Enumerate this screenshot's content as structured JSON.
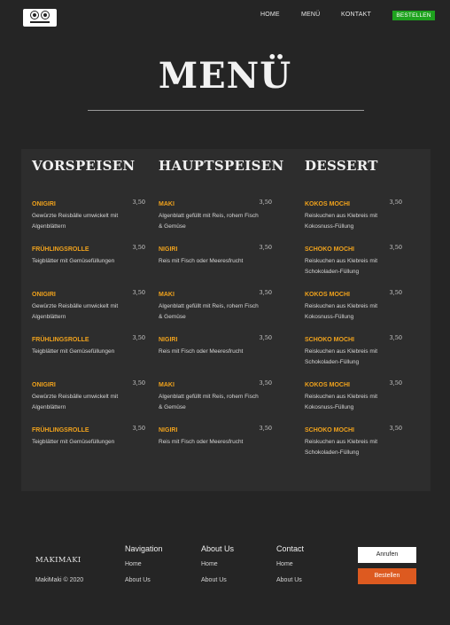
{
  "header": {
    "logo_icon": "sushi-logo-icon",
    "nav": [
      "HOME",
      "MENÜ",
      "KONTAKT"
    ],
    "order_label": "BESTELLEN",
    "order_color": "#1ea21e"
  },
  "page": {
    "title": "MENÜ"
  },
  "menu": {
    "columns": [
      {
        "heading": "VORSPEISEN",
        "items": [
          {
            "name": "ONIGIRI",
            "price": "3,50",
            "desc": "Gewürzte Reisbälle umwickelt mit Algenblättern"
          },
          {
            "name": "FRÜHLINGSROLLE",
            "price": "3,50",
            "desc": "Teigblätter mit Gemüsefüllungen"
          },
          {
            "name": "ONIGIRI",
            "price": "3,50",
            "desc": "Gewürzte Reisbälle umwickelt mit Algenblättern"
          },
          {
            "name": "FRÜHLINGSROLLE",
            "price": "3,50",
            "desc": "Teigblätter mit Gemüsefüllungen"
          },
          {
            "name": "ONIGIRI",
            "price": "3,50",
            "desc": "Gewürzte Reisbälle umwickelt mit Algenblättern"
          },
          {
            "name": "FRÜHLINGSROLLE",
            "price": "3,50",
            "desc": "Teigblätter mit Gemüsefüllungen"
          }
        ]
      },
      {
        "heading": "HAUPTSPEISEN",
        "items": [
          {
            "name": "MAKI",
            "price": "3,50",
            "desc": "Algenblatt gefüllt mit Reis, rohem Fisch & Gemüse"
          },
          {
            "name": "NIGIRI",
            "price": "3,50",
            "desc": "Reis mit Fisch oder Meeresfrucht"
          },
          {
            "name": "MAKI",
            "price": "3,50",
            "desc": "Algenblatt gefüllt mit Reis, rohem Fisch & Gemüse"
          },
          {
            "name": "NIGIRI",
            "price": "3,50",
            "desc": "Reis mit Fisch oder Meeresfrucht"
          },
          {
            "name": "MAKI",
            "price": "3,50",
            "desc": "Algenblatt gefüllt mit Reis, rohem Fisch & Gemüse"
          },
          {
            "name": "NIGIRI",
            "price": "3,50",
            "desc": "Reis mit Fisch oder Meeresfrucht"
          }
        ]
      },
      {
        "heading": "DESSERT",
        "items": [
          {
            "name": "KOKOS MOCHI",
            "price": "3,50",
            "desc": "Reiskuchen aus Klebreis mit Kokosnuss-Füllung"
          },
          {
            "name": "SCHOKO MOCHI",
            "price": "3,50",
            "desc": "Reiskuchen aus Klebreis mit Schokoladen-Füllung"
          },
          {
            "name": "KOKOS MOCHI",
            "price": "3,50",
            "desc": "Reiskuchen aus Klebreis mit Kokosnuss-Füllung"
          },
          {
            "name": "SCHOKO MOCHI",
            "price": "3,50",
            "desc": "Reiskuchen aus Klebreis mit Schokoladen-Füllung"
          },
          {
            "name": "KOKOS MOCHI",
            "price": "3,50",
            "desc": "Reiskuchen aus Klebreis mit Kokosnuss-Füllung"
          },
          {
            "name": "SCHOKO MOCHI",
            "price": "3,50",
            "desc": "Reiskuchen aus Klebreis mit Schokoladen-Füllung"
          }
        ]
      }
    ]
  },
  "footer": {
    "brand": "MAKIMAKI",
    "copyright": "MakiMaki © 2020",
    "columns": [
      {
        "heading": "Navigation",
        "links": [
          "Home",
          "About Us"
        ]
      },
      {
        "heading": "About Us",
        "links": [
          "Home",
          "About Us"
        ]
      },
      {
        "heading": "Contact",
        "links": [
          "Home",
          "About Us"
        ]
      }
    ],
    "call_label": "Anrufen",
    "buy_label": "Bestellen",
    "buy_color": "#dd5a20"
  }
}
